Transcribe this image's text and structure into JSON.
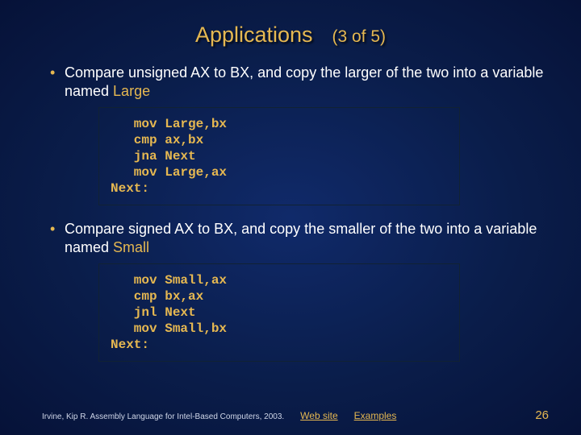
{
  "title": "Applications",
  "title_sub": "(3 of 5)",
  "bullets": [
    {
      "pre": "Compare unsigned AX to BX, and copy the larger of the two into a variable named ",
      "hl": "Large"
    },
    {
      "pre": "Compare signed AX to BX, and copy the smaller of the two into a variable named ",
      "hl": "Small"
    }
  ],
  "code_blocks": [
    "   mov Large,bx\n   cmp ax,bx\n   jna Next\n   mov Large,ax\nNext:",
    "   mov Small,ax\n   cmp bx,ax\n   jnl Next\n   mov Small,bx\nNext:"
  ],
  "footer": {
    "credit": "Irvine, Kip R. Assembly Language for Intel-Based Computers, 2003.",
    "links": [
      "Web site",
      "Examples"
    ],
    "page": "26"
  }
}
